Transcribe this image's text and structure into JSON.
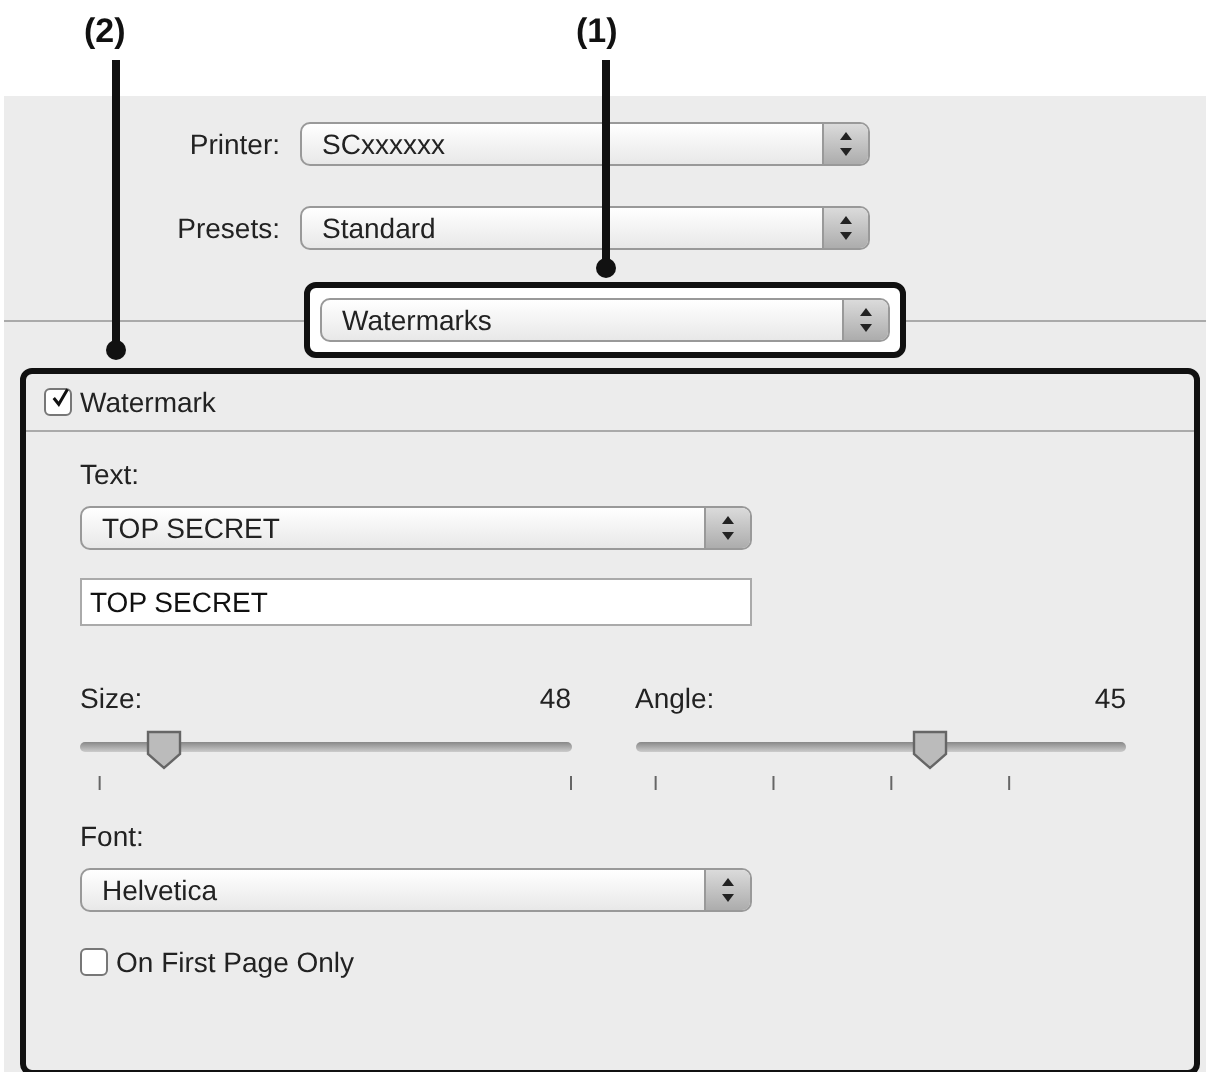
{
  "callouts": [
    {
      "label": "(2)"
    },
    {
      "label": "(1)"
    }
  ],
  "printer": {
    "label": "Printer:",
    "value": "SCxxxxxx"
  },
  "presets": {
    "label": "Presets:",
    "value": "Standard"
  },
  "panel_menu": {
    "value": "Watermarks"
  },
  "watermark": {
    "label": "Watermark",
    "checked": true
  },
  "text": {
    "label": "Text:",
    "preset": "TOP SECRET",
    "value": "TOP SECRET"
  },
  "sliders": [
    {
      "label": "Size:",
      "reading": "48",
      "level": 0.17
    },
    {
      "label": "Angle:",
      "reading": "45",
      "level": 0.6
    }
  ],
  "font": {
    "label": "Font:",
    "value": "Helvetica"
  },
  "first_page_only": {
    "label": "On First Page Only",
    "checked": false
  }
}
